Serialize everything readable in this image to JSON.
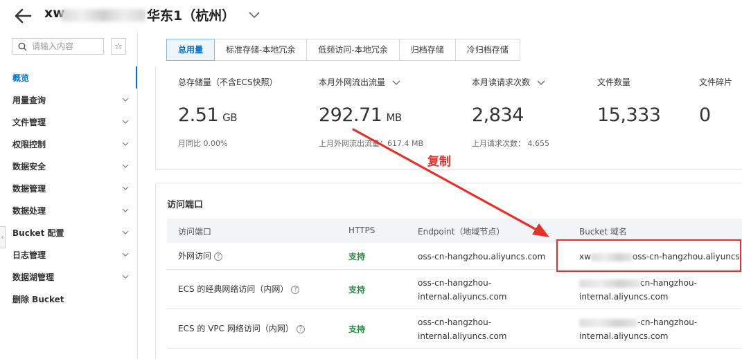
{
  "header": {
    "title_prefix": "xw",
    "title_suffix": "华东1（杭州）"
  },
  "sidebar": {
    "search_placeholder": "请输入内容",
    "items": [
      {
        "label": "概览",
        "active": true,
        "has_chevron": false
      },
      {
        "label": "用量查询",
        "has_chevron": true
      },
      {
        "label": "文件管理",
        "has_chevron": true
      },
      {
        "label": "权限控制",
        "has_chevron": true
      },
      {
        "label": "数据安全",
        "has_chevron": true
      },
      {
        "label": "数据管理",
        "has_chevron": true
      },
      {
        "label": "数据处理",
        "has_chevron": true
      },
      {
        "label": "Bucket 配置",
        "has_chevron": true
      },
      {
        "label": "日志管理",
        "has_chevron": true
      },
      {
        "label": "数据湖管理",
        "has_chevron": true
      },
      {
        "label": "删除 Bucket",
        "has_chevron": false
      }
    ]
  },
  "tabs": [
    {
      "label": "总用量",
      "active": true
    },
    {
      "label": "标准存储-本地冗余"
    },
    {
      "label": "低频访问-本地冗余"
    },
    {
      "label": "归档存储"
    },
    {
      "label": "冷归档存储"
    }
  ],
  "stats": [
    {
      "label": "总存储量（不含ECS快照）",
      "value": "2.51",
      "unit": "GB",
      "sub": "月同比  0.00%"
    },
    {
      "label": "本月外网流出流量",
      "value": "292.71",
      "unit": "MB",
      "sub": "上月外网流出流量：617.4 MB"
    },
    {
      "label": "本月读请求次数",
      "value": "2,834",
      "unit": "",
      "sub": "上月请求次数：  4,655"
    },
    {
      "label": "文件数量",
      "value": "15,333",
      "unit": "",
      "sub": ""
    },
    {
      "label": "文件碎片",
      "value": "0",
      "unit": "",
      "sub": ""
    }
  ],
  "endpoints": {
    "title": "访问端口",
    "columns": [
      "访问端口",
      "HTTPS",
      "Endpoint（地域节点）",
      "Bucket 域名"
    ],
    "rows": [
      {
        "name": "外网访问",
        "https": "支持",
        "endpoint": "oss-cn-hangzhou.aliyuncs.com",
        "bucket_prefix": "xw",
        "bucket_suffix": "oss-cn-hangzhou.aliyuncs.com"
      },
      {
        "name": "ECS 的经典网络访问（内网）",
        "https": "支持",
        "endpoint_line1": "oss-cn-hangzhou-",
        "endpoint_line2": "internal.aliyuncs.com",
        "bucket_line1": "cn-hangzhou-",
        "bucket_line2": "internal.aliyuncs.com"
      },
      {
        "name": "ECS 的 VPC 网络访问（内网）",
        "https": "支持",
        "endpoint_line1": "oss-cn-hangzhou-",
        "endpoint_line2": "internal.aliyuncs.com",
        "bucket_line1": "-cn-hangzhou-",
        "bucket_line2": "internal.aliyuncs.com"
      }
    ]
  },
  "annotation": {
    "text": "复制",
    "color": "#e8302a"
  },
  "colors": {
    "accent": "#0070cc",
    "support_green": "#1e8e3e",
    "annotation_red": "#e8302a"
  }
}
